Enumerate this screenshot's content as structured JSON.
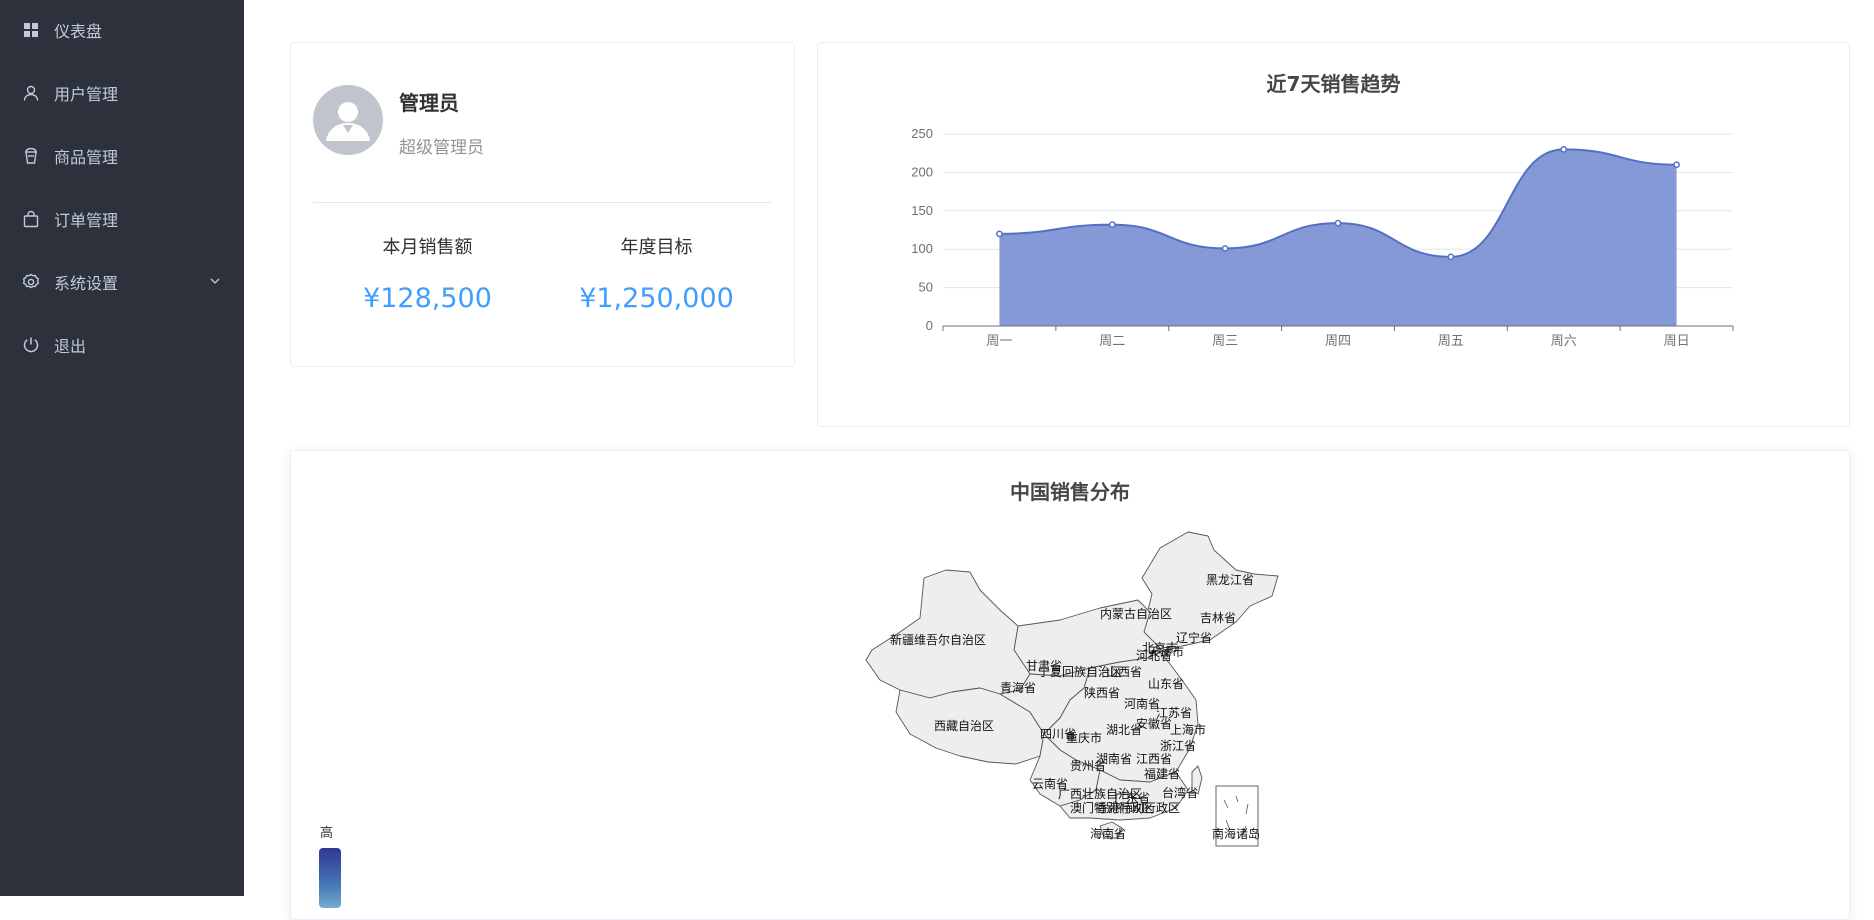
{
  "sidebar": {
    "items": [
      {
        "label": "仪表盘",
        "icon": "grid-icon"
      },
      {
        "label": "用户管理",
        "icon": "user-icon"
      },
      {
        "label": "商品管理",
        "icon": "goods-icon"
      },
      {
        "label": "订单管理",
        "icon": "bag-icon"
      },
      {
        "label": "系统设置",
        "icon": "gear-icon"
      },
      {
        "label": "退出",
        "icon": "power-icon"
      }
    ]
  },
  "profile": {
    "name": "管理员",
    "role": "超级管理员",
    "stats": [
      {
        "label": "本月销售额",
        "value": "¥128,500"
      },
      {
        "label": "年度目标",
        "value": "¥1,250,000"
      }
    ]
  },
  "colors": {
    "sidebar_bg": "#2c313c",
    "accent": "#409eff",
    "series_line": "#5470c6",
    "series_fill": "#7d94d4"
  },
  "chart_data": [
    {
      "type": "area",
      "title": "近7天销售趋势",
      "categories": [
        "周一",
        "周二",
        "周三",
        "周四",
        "周五",
        "周六",
        "周日"
      ],
      "values": [
        120,
        132,
        101,
        134,
        90,
        230,
        210
      ],
      "ylim": [
        0,
        250
      ],
      "yticks": [
        "0",
        "50",
        "100",
        "150",
        "200",
        "250"
      ],
      "smooth": true,
      "grid": true
    }
  ],
  "map": {
    "title": "中国销售分布",
    "visual_map_high_label": "高",
    "provinces": [
      {
        "name": "黑龙江省"
      },
      {
        "name": "内蒙古自治区"
      },
      {
        "name": "吉林省"
      },
      {
        "name": "新疆维吾尔自治区"
      },
      {
        "name": "辽宁省"
      },
      {
        "name": "北京市"
      },
      {
        "name": "天津市"
      },
      {
        "name": "河北省"
      },
      {
        "name": "甘肃省"
      },
      {
        "name": "宁夏回族自治区"
      },
      {
        "name": "山西省"
      },
      {
        "name": "青海省"
      },
      {
        "name": "山东省"
      },
      {
        "name": "陕西省"
      },
      {
        "name": "河南省"
      },
      {
        "name": "江苏省"
      },
      {
        "name": "西藏自治区"
      },
      {
        "name": "四川省"
      },
      {
        "name": "湖北省"
      },
      {
        "name": "安徽省"
      },
      {
        "name": "上海市"
      },
      {
        "name": "重庆市"
      },
      {
        "name": "浙江省"
      },
      {
        "name": "湖南省"
      },
      {
        "name": "江西省"
      },
      {
        "name": "贵州省"
      },
      {
        "name": "福建省"
      },
      {
        "name": "云南省"
      },
      {
        "name": "广西壮族自治区"
      },
      {
        "name": "广东省"
      },
      {
        "name": "台湾省"
      },
      {
        "name": "香港特别行政区"
      },
      {
        "name": "澳门特别行政区"
      },
      {
        "name": "海南省"
      },
      {
        "name": "南海诸岛"
      }
    ]
  }
}
